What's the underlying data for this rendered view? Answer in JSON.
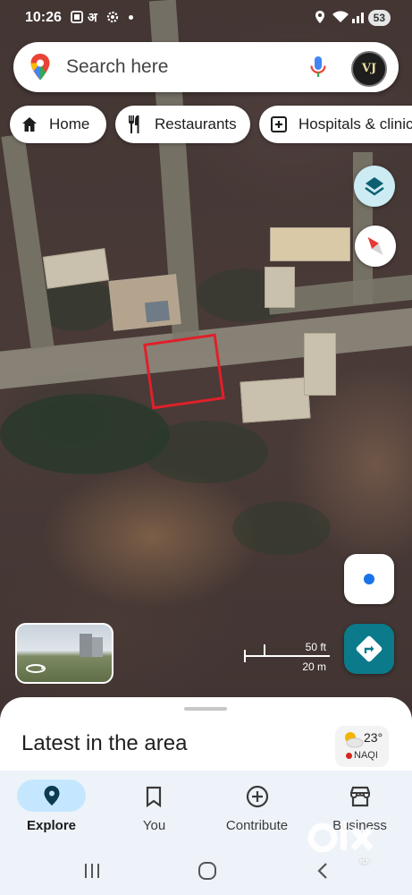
{
  "status_bar": {
    "time": "10:26",
    "carrier_glyph": "अ",
    "battery": "53"
  },
  "search": {
    "placeholder": "Search here",
    "avatar_initials": "VJ"
  },
  "chips": [
    {
      "label": "Home",
      "icon": "home-icon"
    },
    {
      "label": "Restaurants",
      "icon": "restaurant-icon"
    },
    {
      "label": "Hospitals & clinics",
      "icon": "hospital-icon"
    }
  ],
  "map": {
    "scale_feet": "50 ft",
    "scale_meters": "20 m",
    "marked_plot_color": "#e0202a",
    "controls": [
      "layers-icon",
      "compass-icon",
      "my-location-icon",
      "directions-icon"
    ]
  },
  "sheet": {
    "title": "Latest in the area",
    "weather": {
      "temperature": "23°",
      "aqi": "NAQI",
      "icon": "partly-cloudy-icon"
    }
  },
  "bottom_nav": {
    "items": [
      {
        "label": "Explore",
        "icon": "explore-pin-icon",
        "active": true
      },
      {
        "label": "You",
        "icon": "bookmark-icon",
        "active": false
      },
      {
        "label": "Contribute",
        "icon": "add-circle-icon",
        "active": false
      },
      {
        "label": "Business",
        "icon": "storefront-icon",
        "active": false
      }
    ]
  },
  "watermark": {
    "text": "olx",
    "subtext": "INDIA"
  },
  "colors": {
    "accent_blue": "#1a73e8",
    "directions_teal": "#0b7a8a",
    "explore_pill": "#c4e7ff",
    "nav_background": "#eef3f9"
  }
}
